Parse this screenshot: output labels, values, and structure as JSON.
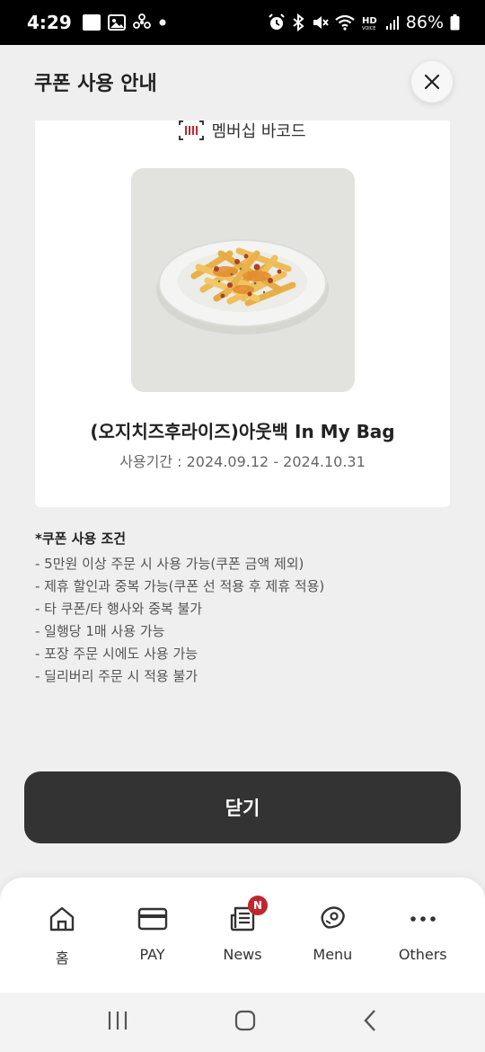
{
  "status_bar": {
    "time": "4:29",
    "battery": "86%",
    "icons": [
      "app-notification-icon",
      "image-icon",
      "fan-icon",
      "dot-icon",
      "alarm-icon",
      "bluetooth-icon",
      "mute-icon",
      "wifi-icon",
      "hd-voice-icon",
      "signal-icon",
      "battery-icon"
    ]
  },
  "header": {
    "title": "쿠폰 사용 안내",
    "close_icon": "close-icon"
  },
  "coupon": {
    "barcode_label": "멤버십 바코드",
    "barcode_icon": "barcode-icon",
    "product_name": "(오지치즈후라이즈)아웃백 In My Bag",
    "period": "사용기간 : 2024.09.12 - 2024.10.31"
  },
  "conditions": {
    "title": "*쿠폰 사용 조건",
    "items": [
      "- 5만원 이상 주문 시 사용 가능(쿠폰 금액 제외)",
      "- 제휴 할인과 중복 가능(쿠폰 선 적용 후 제휴 적용)",
      "- 타 쿠폰/타 행사와 중복 불가",
      "- 일행당 1매 사용 가능",
      "- 포장 주문 시에도 사용 가능",
      "- 딜리버리 주문 시 적용 불가"
    ]
  },
  "close_button": {
    "label": "닫기"
  },
  "bottom_nav": {
    "items": [
      {
        "label": "홈",
        "icon": "home-icon"
      },
      {
        "label": "PAY",
        "icon": "card-icon"
      },
      {
        "label": "News",
        "icon": "news-icon",
        "badge": "N"
      },
      {
        "label": "Menu",
        "icon": "steak-icon"
      },
      {
        "label": "Others",
        "icon": "more-icon"
      }
    ]
  },
  "colors": {
    "background": "#efefef",
    "button_dark": "#333333",
    "badge_red": "#c0262d",
    "barcode_red": "#c0262d"
  }
}
